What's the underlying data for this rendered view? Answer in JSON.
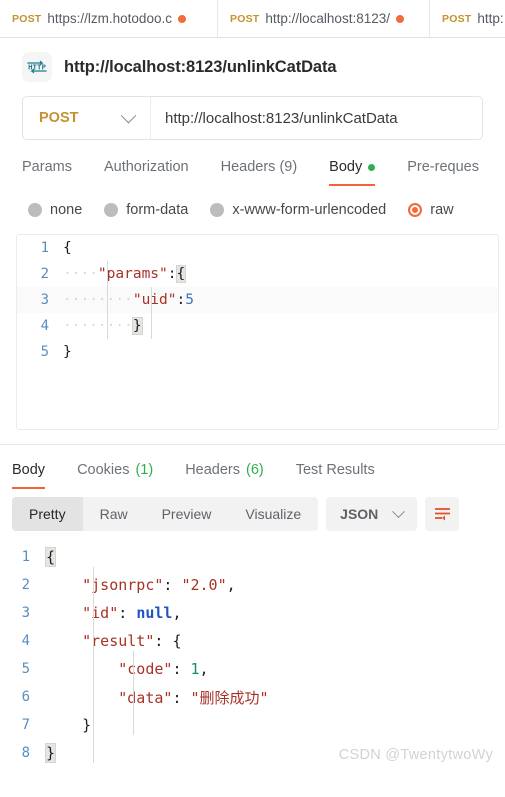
{
  "tabs": [
    {
      "method": "POST",
      "url": "https://lzm.hotodoo.c",
      "unsaved": true
    },
    {
      "method": "POST",
      "url": "http://localhost:8123/",
      "unsaved": true
    },
    {
      "method": "POST",
      "url": "http:",
      "unsaved": false
    }
  ],
  "request": {
    "icon": "http-protocol-icon",
    "title": "http://localhost:8123/unlinkCatData",
    "method": "POST",
    "url": "http://localhost:8123/unlinkCatData",
    "section_tabs": [
      {
        "label": "Params",
        "active": false
      },
      {
        "label": "Authorization",
        "active": false
      },
      {
        "label": "Headers (9)",
        "active": false
      },
      {
        "label": "Body",
        "active": true,
        "dot": true
      },
      {
        "label": "Pre-reques",
        "active": false
      }
    ],
    "body_types": [
      {
        "label": "none",
        "selected": false
      },
      {
        "label": "form-data",
        "selected": false
      },
      {
        "label": "x-www-form-urlencoded",
        "selected": false
      },
      {
        "label": "raw",
        "selected": true
      }
    ],
    "body_lines": [
      {
        "no": "1",
        "parts": [
          {
            "t": "{",
            "c": "pun"
          }
        ]
      },
      {
        "no": "2",
        "parts": [
          {
            "t": "····",
            "c": "ind"
          },
          {
            "t": "\"params\"",
            "c": "str"
          },
          {
            "t": ":",
            "c": "pun"
          },
          {
            "t": "{",
            "c": "brace"
          }
        ]
      },
      {
        "no": "3",
        "parts": [
          {
            "t": "····",
            "c": "ind"
          },
          {
            "t": "····",
            "c": "ind"
          },
          {
            "t": "\"uid\"",
            "c": "str"
          },
          {
            "t": ":",
            "c": "pun"
          },
          {
            "t": "5",
            "c": "num"
          }
        ]
      },
      {
        "no": "4",
        "parts": [
          {
            "t": "····",
            "c": "ind"
          },
          {
            "t": "····",
            "c": "ind"
          },
          {
            "t": "}",
            "c": "brace"
          }
        ]
      },
      {
        "no": "5",
        "parts": [
          {
            "t": "}",
            "c": "pun"
          }
        ]
      }
    ]
  },
  "response": {
    "tabs": [
      {
        "label": "Body",
        "count": "",
        "active": true
      },
      {
        "label": "Cookies",
        "count": "(1)",
        "active": false
      },
      {
        "label": "Headers",
        "count": "(6)",
        "active": false
      },
      {
        "label": "Test Results",
        "count": "",
        "active": false
      }
    ],
    "view_modes": [
      {
        "label": "Pretty",
        "active": true
      },
      {
        "label": "Raw",
        "active": false
      },
      {
        "label": "Preview",
        "active": false
      },
      {
        "label": "Visualize",
        "active": false
      }
    ],
    "format": "JSON",
    "wrap_icon": "wrap-lines-icon",
    "body_lines": [
      {
        "no": "1",
        "parts": [
          {
            "t": "{",
            "c": "brace"
          }
        ]
      },
      {
        "no": "2",
        "parts": [
          {
            "t": "    ",
            "c": "pun"
          },
          {
            "t": "\"jsonrpc\"",
            "c": "str"
          },
          {
            "t": ": ",
            "c": "pun"
          },
          {
            "t": "\"2.0\"",
            "c": "str"
          },
          {
            "t": ",",
            "c": "pun"
          }
        ]
      },
      {
        "no": "3",
        "parts": [
          {
            "t": "    ",
            "c": "pun"
          },
          {
            "t": "\"id\"",
            "c": "str"
          },
          {
            "t": ": ",
            "c": "pun"
          },
          {
            "t": "null",
            "c": "null"
          },
          {
            "t": ",",
            "c": "pun"
          }
        ]
      },
      {
        "no": "4",
        "parts": [
          {
            "t": "    ",
            "c": "pun"
          },
          {
            "t": "\"result\"",
            "c": "str"
          },
          {
            "t": ": ",
            "c": "pun"
          },
          {
            "t": "{",
            "c": "pun"
          }
        ]
      },
      {
        "no": "5",
        "parts": [
          {
            "t": "        ",
            "c": "pun"
          },
          {
            "t": "\"code\"",
            "c": "str"
          },
          {
            "t": ": ",
            "c": "pun"
          },
          {
            "t": "1",
            "c": "numg"
          },
          {
            "t": ",",
            "c": "pun"
          }
        ]
      },
      {
        "no": "6",
        "parts": [
          {
            "t": "        ",
            "c": "pun"
          },
          {
            "t": "\"data\"",
            "c": "str"
          },
          {
            "t": ": ",
            "c": "pun"
          },
          {
            "t": "\"删除成功\"",
            "c": "str"
          }
        ]
      },
      {
        "no": "7",
        "parts": [
          {
            "t": "    ",
            "c": "pun"
          },
          {
            "t": "}",
            "c": "pun"
          }
        ]
      },
      {
        "no": "8",
        "parts": [
          {
            "t": "}",
            "c": "brace"
          }
        ]
      }
    ]
  },
  "watermark": "CSDN @TwentytwoWy",
  "colors": {
    "accent_orange": "#ef6533",
    "method_amber": "#c4922e",
    "green": "#2fae4f",
    "string_red": "#a93226",
    "null_blue": "#1f55c4",
    "number_green": "#13925b",
    "linenum_blue": "#5b8dbd"
  }
}
